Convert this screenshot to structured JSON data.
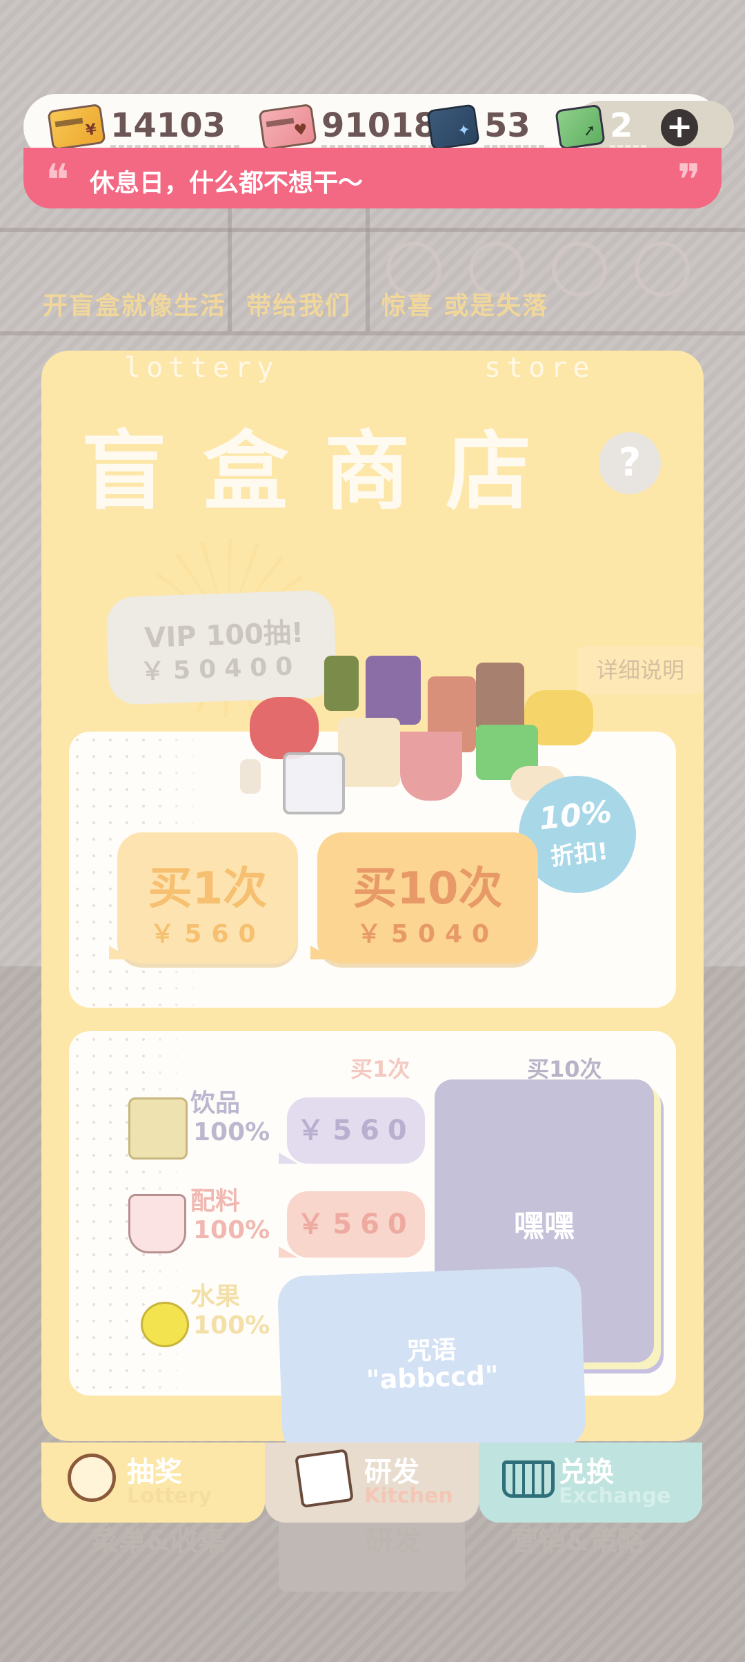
{
  "currency": {
    "gold_card": "14103",
    "pink_card": "91018",
    "blue_card": "53",
    "green_ticket": "2",
    "add_label": "+"
  },
  "message": {
    "text": "休息日，什么都不想干～",
    "open_quote": "❝",
    "close_quote": "❞"
  },
  "tagline": "开盲盒就像生活  带给我们   惊喜 或是失落",
  "store": {
    "en_left": "lottery",
    "en_right": "store",
    "title": "盲盒商店",
    "help": "?",
    "vip_title": "VIP 100抽!",
    "vip_price": "￥50400",
    "detail": "详细说明",
    "buy_one": "买1次",
    "buy_one_price": "￥560",
    "buy_ten": "买10次",
    "buy_ten_price": "￥5040",
    "discount_line1": "10%",
    "discount_line2": "折扣!"
  },
  "categories": {
    "col_one": "买1次",
    "col_ten": "买10次",
    "items": [
      {
        "name": "饮品",
        "pct": "100%",
        "price": "￥560"
      },
      {
        "name": "配料",
        "pct": "100%",
        "price": "￥560"
      },
      {
        "name": "水果",
        "pct": "100%",
        "price": ""
      }
    ],
    "box_text": "嘿嘿"
  },
  "spell": {
    "title": "咒语",
    "value": "\"abbccd\""
  },
  "tabs": [
    {
      "label": "抽奖",
      "sub": "Lottery"
    },
    {
      "label": "研发",
      "sub": "Kitchen"
    },
    {
      "label": "兑换",
      "sub": "Exchange"
    }
  ],
  "ghost_tabs": [
    "菜单&收集",
    "研发",
    "营销&策略"
  ],
  "colors": {
    "panel": "#fde7a8",
    "pink_bar": "#f36882",
    "tab_lottery": "#fde7a8",
    "tab_kitchen": "#e8dccf",
    "tab_exchange": "#bfe3de"
  }
}
